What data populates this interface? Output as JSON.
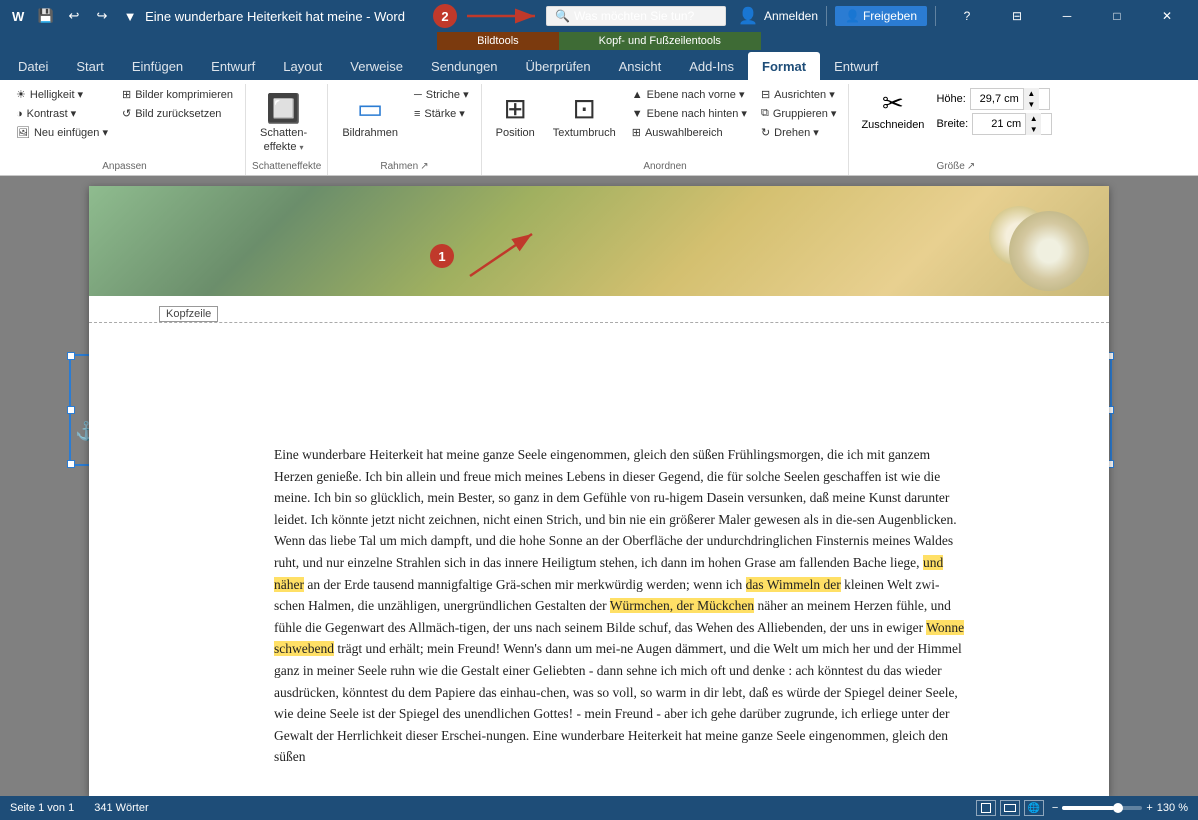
{
  "titleBar": {
    "title": "Eine wunderbare Heiterkeit hat meine - Word",
    "saveLabel": "💾",
    "undoLabel": "↩",
    "redoLabel": "↪",
    "customizeLabel": "▼",
    "helpLabel": "?",
    "restoreLabel": "❐",
    "minimizeLabel": "─",
    "maximizeLabel": "□",
    "closeLabel": "✕"
  },
  "contextualTabs": {
    "bildtools": "Bildtools",
    "kopfUndFusszeilen": "Kopf- und Fußzeilentools"
  },
  "ribbonTabs": {
    "datei": "Datei",
    "start": "Start",
    "einfuegen": "Einfügen",
    "entwurf": "Entwurf",
    "layout": "Layout",
    "verweise": "Verweise",
    "sendungen": "Sendungen",
    "ueberpruefen": "Überprüfen",
    "ansicht": "Ansicht",
    "addIns": "Add-Ins",
    "format": "Format",
    "entwurf2": "Entwurf"
  },
  "signIn": {
    "label": "Anmelden",
    "searchLabel": "Was möchten Sie tun?",
    "shareLabel": "Freigeben",
    "shareIcon": "👤"
  },
  "ribbon": {
    "groups": {
      "anpassen": {
        "label": "Anpassen",
        "helligkeit": "Helligkeit ▾",
        "kontrast": "Kontrast ▾",
        "neuEinfuegen": "Neu einfügen ▾",
        "bilderKomprimieren": "Bilder komprimieren",
        "bildZuruecksetzen": "Bild zurücksetzen"
      },
      "schatteneffekte": {
        "label": "Schatteneffekte",
        "schatteneffekte": "Schatten-\neffekte ▾"
      },
      "rahmen": {
        "label": "Rahmen",
        "bildrahmen": "Bildrahmen",
        "striche": "Striche ▾",
        "staerke": "Stärke ▾",
        "dialogIcon": "↗"
      },
      "anordnen": {
        "label": "Anordnen",
        "position": "Position",
        "textumbruch": "Textumbruch",
        "ebeneNachVorne": "Ebene nach vorne ▾",
        "ebeneNachHinten": "Ebene nach hinten ▾",
        "ausrichten": "Ausrichten ▾",
        "gruppieren": "Gruppieren ▾",
        "auswahlbereich": "Auswahlbereich",
        "drehen": "Drehen ▾"
      },
      "groesse": {
        "label": "Größe",
        "zuschneiden": "Zuschneiden",
        "hoehe": "Höhe:",
        "hoeeValue": "29,7 cm",
        "breite": "Breite:",
        "breiteValue": "21 cm",
        "dialogIcon": "↗"
      }
    }
  },
  "document": {
    "kopfzeileLabel": "Kopfzeile",
    "bodyText": "Eine wunderbare Heiterkeit hat meine ganze Seele eingenommen, gleich den süßen Frühlingsmorgen, die ich mit ganzem Herzen genieße. Ich bin allein und freue mich meines Lebens in dieser Gegend, die für solche Seelen geschaffen ist wie die meine. Ich bin so glücklich, mein Bester, so ganz in dem Gefühle von ru-higem Dasein versunken, daß meine Kunst darunter leidet. Ich könnte jetzt nicht zeichnen, nicht einen Strich, und bin nie ein größerer Maler gewesen als in die-sen Augenblicken. Wenn das liebe Tal um mich dampft, und die hohe Sonne an der Oberfläche der undurchdringlichen Finsternis meines Waldes ruht, und nur einzelne Strahlen sich in das innere Heiligtum stehen, ich dann im hohen Grase am fallenden Bache liege, und näher an der Erde tausend mannigfaltige Grä-schen mir merkwürdig werden; wenn ich das Wimmeln der kleinen Welt zwi-schen Halmen, die unzähligen, unergründlichen Gestalten der Würmchen, der Mückchen näher an meinem Herzen fühle, und fühle die Gegenwart des Allmäch-tigen, der uns nach seinem Bilde schuf, das Wehen des Alliebenden, der uns in ewiger Wonne schwebend trägt und erhält; mein Freund! Wenn's dann um mei-ne Augen dämmert, und die Welt um mich her und der Himmel ganz in meiner Seele ruhn wie die Gestalt einer Geliebten - dann sehne ich mich oft und denke : ach könntest du das wieder ausdrücken, könntest du dem Papiere das einhau-chen, was so voll, so warm in dir lebt, daß es würde der Spiegel deiner Seele, wie deine Seele ist der Spiegel des unendlichen Gottes! - mein Freund - aber ich gehe darüber zugrunde, ich erliege unter der Gewalt der Herrlichkeit dieser Erschei-nungen. Eine wunderbare Heiterkeit hat meine ganze Seele eingenommen, gleich den süßen"
  },
  "statusBar": {
    "pageInfo": "Seite 1 von 1",
    "wordCount": "341 Wörter",
    "zoomLevel": "130 %",
    "zoomMinus": "−",
    "zoomPlus": "+"
  },
  "annotations": {
    "badge1": "1",
    "badge2": "2",
    "arrowText1": "→",
    "arrowText2": "→"
  }
}
